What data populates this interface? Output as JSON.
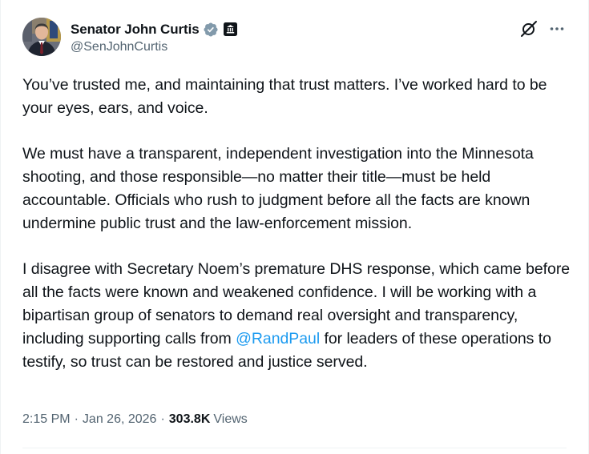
{
  "author": {
    "display_name": "Senator John Curtis",
    "handle": "@SenJohnCurtis",
    "verified_icon": "verified-badge-icon",
    "affiliation_icon": "government-badge-icon"
  },
  "actions": {
    "grok_icon": "grok-icon",
    "more_icon": "more-options-icon"
  },
  "tweet": {
    "p1": "You’ve trusted me, and maintaining that trust matters. I’ve worked hard to be your eyes, ears, and voice.",
    "p2": "We must have a transparent, independent investigation into the Minnesota shooting, and those responsible—no matter their title—must be held accountable. Officials who rush to judgment before all the facts are known undermine public trust and the law-enforcement mission.",
    "p3_before": "I disagree with Secretary Noem’s premature DHS response, which came before all the facts were known and weakened confidence. I will be working with a bipartisan group of senators to demand real oversight and transparency, including supporting calls from ",
    "p3_mention": "@RandPaul",
    "p3_after": " for leaders of these operations to testify, so trust can be restored and justice served."
  },
  "meta": {
    "time": "2:15 PM",
    "separator": "·",
    "date": "Jan 26, 2026",
    "views_count": "303.8K",
    "views_label": "Views"
  },
  "colors": {
    "text": "#0f1419",
    "secondary": "#536471",
    "link": "#1d9bf0",
    "verified": "#829aab"
  }
}
